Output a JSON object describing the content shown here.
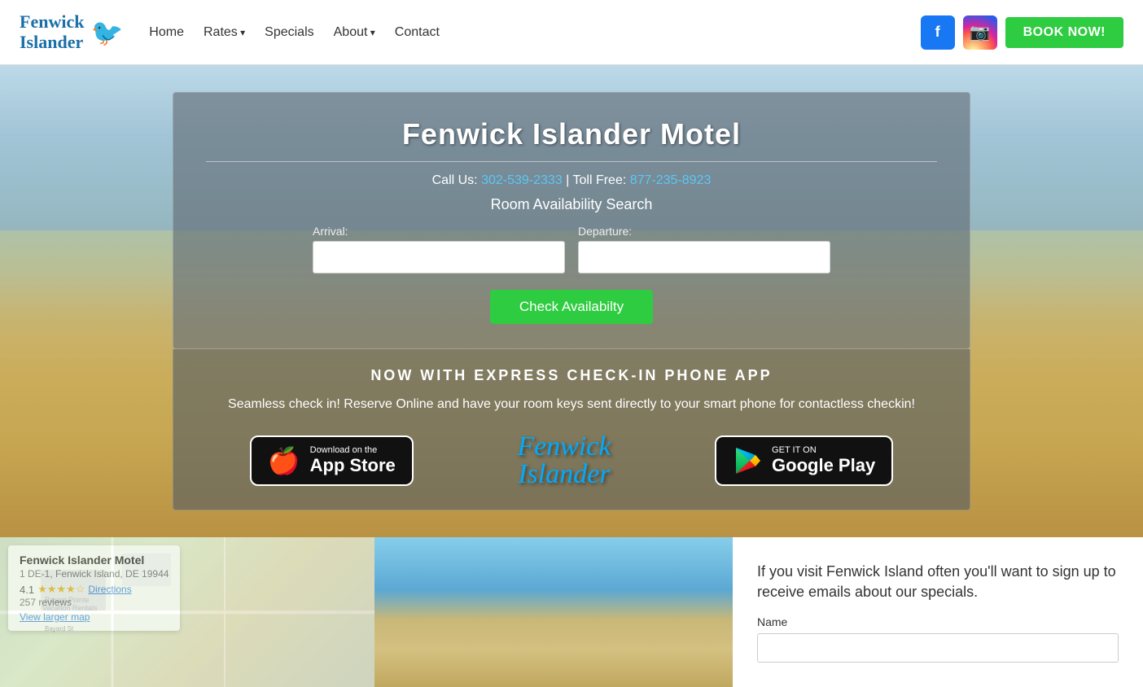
{
  "nav": {
    "logo_line1": "Fenwick",
    "logo_line2": "Islander",
    "links": [
      {
        "label": "Home",
        "dropdown": false,
        "name": "home"
      },
      {
        "label": "Rates",
        "dropdown": true,
        "name": "rates"
      },
      {
        "label": "Specials",
        "dropdown": false,
        "name": "specials"
      },
      {
        "label": "About",
        "dropdown": true,
        "name": "about"
      },
      {
        "label": "Contact",
        "dropdown": false,
        "name": "contact"
      }
    ],
    "book_label": "BOOK NOW!",
    "facebook_label": "f",
    "instagram_label": "ig"
  },
  "hero": {
    "title": "Fenwick Islander Motel",
    "call_us_label": "Call Us:",
    "phone1": "302-539-2333",
    "toll_free_label": "| Toll Free:",
    "phone2": "877-235-8923",
    "search_title": "Room Availability Search",
    "arrival_label": "Arrival:",
    "departure_label": "Departure:",
    "check_btn_label": "Check Availabilty",
    "arrival_placeholder": "",
    "departure_placeholder": ""
  },
  "app_section": {
    "title": "NOW WITH EXPRESS CHECK-IN PHONE APP",
    "description": "Seamless check in! Reserve Online and have your room keys sent directly to your smart phone for contactless checkin!",
    "app_store_sub": "Download on the",
    "app_store_main": "App Store",
    "google_play_sub": "GET IT ON",
    "google_play_main": "Google Play",
    "logo_line1": "Fenwick",
    "logo_line2": "Islander"
  },
  "bottom": {
    "map_card": {
      "title": "Fenwick Islander Motel",
      "address": "1 DE-1, Fenwick Island, DE 19944",
      "rating": "4.1",
      "stars": "★★★★☆",
      "reviews": "257 reviews",
      "directions": "Directions",
      "view_larger": "View larger map"
    },
    "signup": {
      "title": "If you visit Fenwick Island often you'll want to sign up to receive emails about our specials.",
      "name_label": "Name",
      "name_placeholder": ""
    }
  }
}
